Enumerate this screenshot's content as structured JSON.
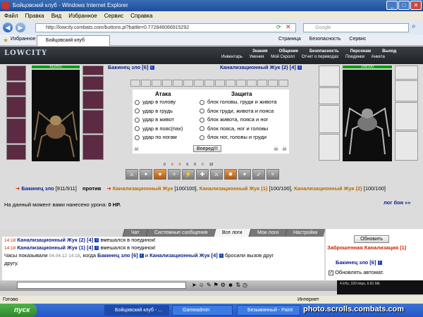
{
  "window": {
    "title": "Бойцовский клуб - Windows Internet Explorer"
  },
  "menu": [
    "Файл",
    "Правка",
    "Вид",
    "Избранное",
    "Сервис",
    "Справка"
  ],
  "address": {
    "url": "http://lowcity.combats.com/buttons.pl?battle=0.772846066915292",
    "search_placeholder": "Google"
  },
  "favorites": {
    "label": "Избранное",
    "tab_title": "Бойцовский клуб"
  },
  "ie_tools": {
    "page": "Страница",
    "safety": "Безопасность",
    "service": "Сервис"
  },
  "game": {
    "logo": "LOWCITY",
    "nav": [
      "Знания",
      "Общение",
      "Безопасность",
      "Персонаж",
      "Выход"
    ],
    "subnav": [
      "Инвентарь",
      "Умения",
      "Мой Скролл",
      "Отчет о переводах",
      "Поединки",
      "Анкета"
    ]
  },
  "fighter_left": {
    "name": "Бакинец зло",
    "level": "[6]",
    "hp": "911/911"
  },
  "fighter_right": {
    "name": "Канализационный Жук (2)",
    "level": "[4]",
    "hp": "100/100"
  },
  "combat": {
    "attack_header": "Атака",
    "defense_header": "Защита",
    "attacks": [
      "удар в голову",
      "удар в грудь",
      "удар в живот",
      "удар в пояс(пах)",
      "удар по ногам"
    ],
    "defenses": [
      "блок головы, груди и живота",
      "блок груди, живота и пояса",
      "блок живота, пояса и ног",
      "блок пояса, ног и головы",
      "блок ног, головы и груди"
    ],
    "go_button": "Вперед!!!",
    "stats": [
      "0",
      "0",
      "0",
      "0",
      "0",
      "0",
      "10"
    ]
  },
  "battle_line": {
    "left": "Бакинец зло",
    "left_hp": "[911/911]",
    "versus": "против",
    "enemy1": "Канализационный Жук",
    "enemy1_hp": "[100/100],",
    "enemy2": "Канализационный Жук (1)",
    "enemy2_hp": "[100/100],",
    "enemy3": "Канализационный Жук (2)",
    "enemy3_hp": "[100/100]"
  },
  "damage_line": {
    "text": "На данный момент вами нанесено урона:",
    "value": "0 HP.",
    "log_link": "лог боя »»"
  },
  "chat_tabs": [
    "Чат",
    "Системные сообщения",
    "Все логи",
    "Мои логи",
    "Настройки"
  ],
  "chat_log": [
    {
      "time": "14:18",
      "name": "Канализационный Жук (2)",
      "level": "[4]",
      "text": "вмешался в поединок!"
    },
    {
      "time": "14:18",
      "name": "Канализационный Жук (1)",
      "level": "[4]",
      "text": "вмешался в поединок!"
    }
  ],
  "chat_msg3": {
    "p1": "Часы показывали",
    "date": "04.04.12",
    "time": "14:18",
    "p2": ", когда",
    "name1": "Бакинец зло",
    "lvl1": "[6]",
    "and": "и",
    "name2": "Канализационный Жук",
    "lvl2": "[4]",
    "p3": "бросили вызов друг",
    "p4": "другу."
  },
  "right_panel": {
    "refresh": "Обновить",
    "location": "Заброшенная Канализация (1)",
    "user": "Бакинец зло",
    "user_level": "[6]",
    "auto": "Обновлять автомат."
  },
  "media": "4 kHz, 320 kbps, 6.81 Mb",
  "status": {
    "done": "Готово",
    "zone": "Интернет"
  },
  "taskbar": {
    "start": "пуск",
    "tasks": [
      "Бойцовский клуб - ...",
      "Gameadmin",
      "Безымянный - Paint"
    ],
    "watermark": "photo.scrolls.combats.com"
  }
}
